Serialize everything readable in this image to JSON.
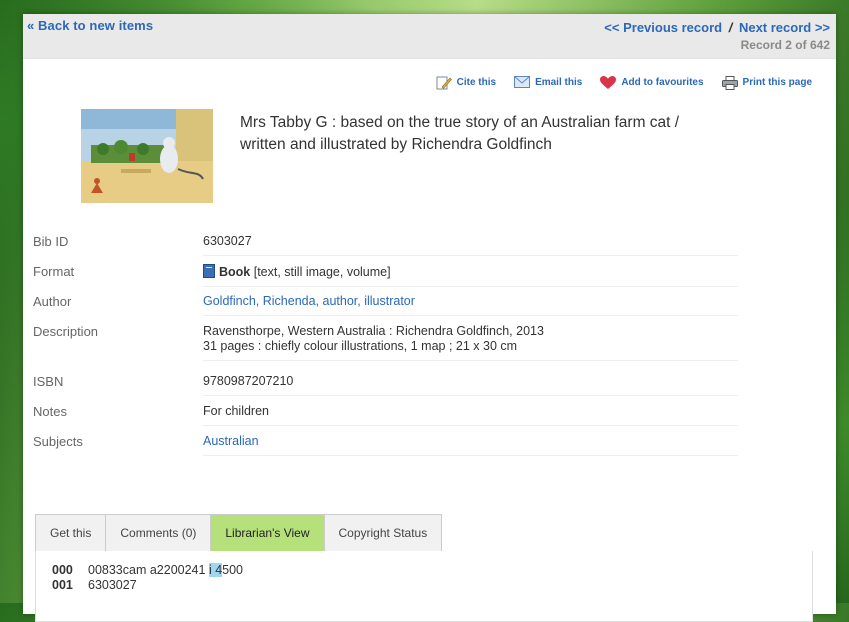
{
  "nav": {
    "back_label": "« Back to new items",
    "prev_label": "<< Previous record",
    "separator": "/",
    "next_label": "Next record >>",
    "record_count": "Record 2 of 642"
  },
  "actions": [
    {
      "label": "Cite this",
      "icon": "pencil-document-icon"
    },
    {
      "label": "Email this",
      "icon": "envelope-icon"
    },
    {
      "label": "Add to favourites",
      "icon": "heart-icon"
    },
    {
      "label": "Print this page",
      "icon": "printer-icon"
    }
  ],
  "record": {
    "title_line1": "Mrs Tabby G : based on the true story of an Australian farm cat /",
    "title_line2": "written and illustrated by Richendra Goldfinch"
  },
  "fields": {
    "bib_id": {
      "label": "Bib ID",
      "value": "6303027"
    },
    "format": {
      "label": "Format",
      "value_bold": "Book",
      "value": "[text, still image, volume]"
    },
    "author": {
      "label": "Author",
      "value": "Goldfinch, Richenda, author, illustrator"
    },
    "description": {
      "label": "Description",
      "line1": "Ravensthorpe, Western Australia : Richendra Goldfinch, 2013",
      "line2": "31 pages : chiefly colour illustrations, 1 map ; 21 x 30 cm"
    },
    "isbn": {
      "label": "ISBN",
      "value": "9780987207210"
    },
    "notes": {
      "label": "Notes",
      "value": "For children"
    },
    "subjects": {
      "label": "Subjects",
      "value": "Australian"
    }
  },
  "tabs": [
    "Get this",
    "Comments (0)",
    "Librarian's View",
    "Copyright Status"
  ],
  "active_tab": "Librarian's View",
  "marc": [
    {
      "tag": "000",
      "pre": "00833cam a2200241 ",
      "highlight": "i 4",
      "post": "500"
    },
    {
      "tag": "001",
      "pre": "6303027",
      "highlight": "",
      "post": ""
    }
  ],
  "colors": {
    "link": "#2c68b8",
    "active_tab": "#b6e07a"
  }
}
